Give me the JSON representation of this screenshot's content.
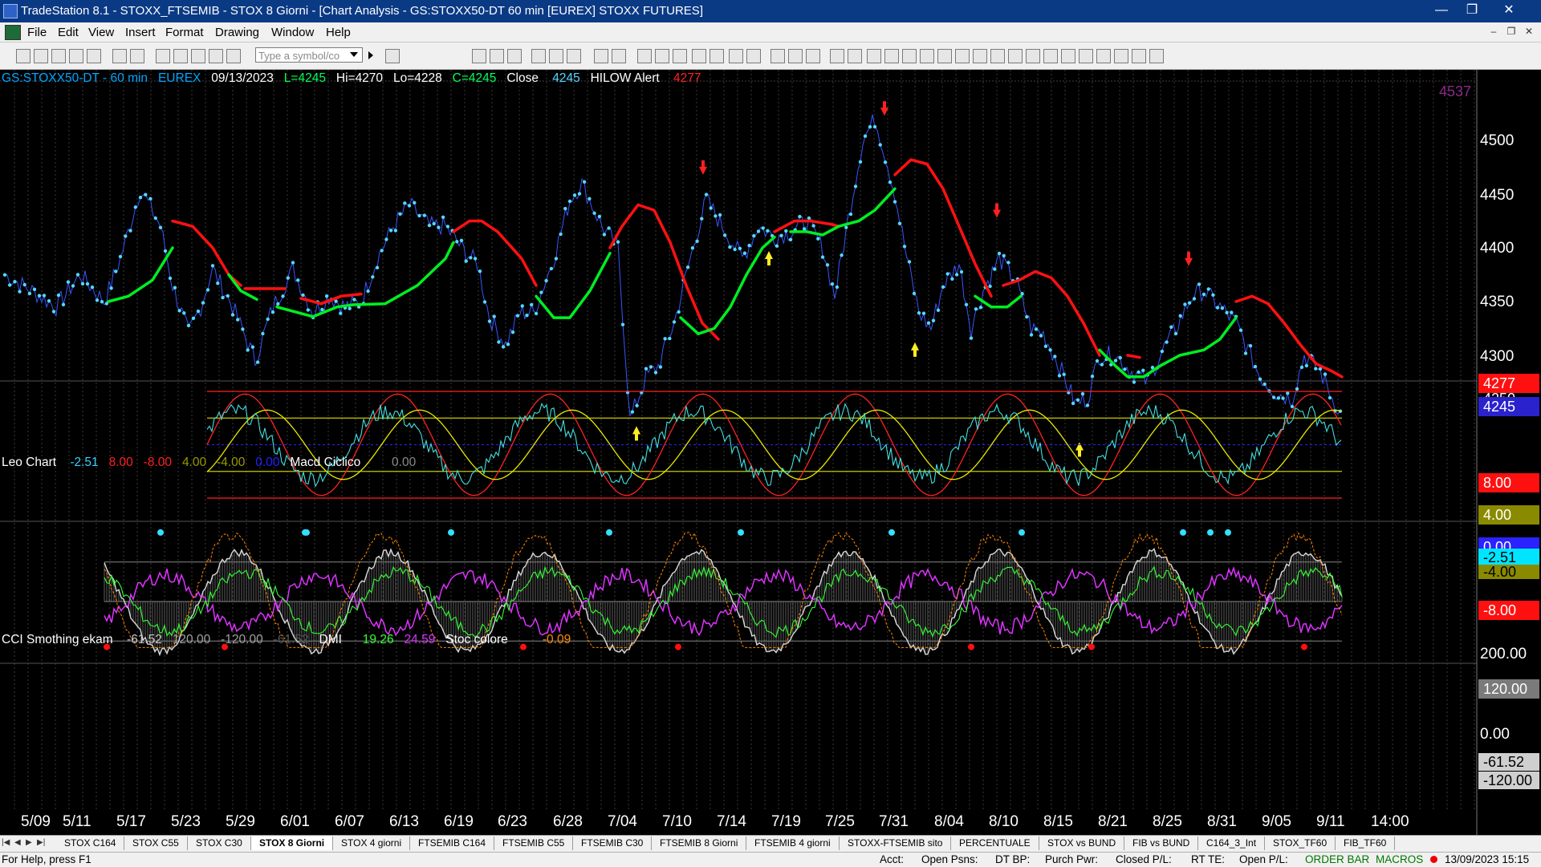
{
  "window": {
    "title": "TradeStation 8.1 - STOXX_FTSEMIB - STOX  8 Giorni - [Chart Analysis - GS:STOXX50-DT  60 min  [EUREX] STOXX FUTURES]",
    "controls": [
      "minimize-icon",
      "restore-icon",
      "close-icon"
    ]
  },
  "menu": {
    "items": [
      "File",
      "Edit",
      "View",
      "Insert",
      "Format",
      "Drawing",
      "Window",
      "Help"
    ]
  },
  "toolbar": {
    "symbol_placeholder": "Type a symbol/co"
  },
  "price_panel": {
    "symbol": "GS:STOXX50-DT - 60 min",
    "exchange": "EUREX",
    "date": "09/13/2023",
    "last": "L=4245",
    "high": "Hi=4270",
    "low": "Lo=4228",
    "close_val": "C=4245",
    "close_label": "Close",
    "close_num": "4245",
    "hilow_label": "HILOW Alert",
    "hilow_num": "4277",
    "top_value": "4537",
    "axis": [
      "4500",
      "4450",
      "4400",
      "4350",
      "4300"
    ],
    "axis_values": [
      4500,
      4450,
      4400,
      4350,
      4300
    ],
    "red_tag": "4277",
    "blue_tag": "4245",
    "hidden_tag": "4250"
  },
  "osc_panel": {
    "name": "Leo Chart",
    "v1": "-2.51",
    "v2": "8.00",
    "v3": "-8.00",
    "v4": "4.00",
    "v5": "-4.00",
    "v6": "0.00",
    "macd_name": "Macd Ciclico",
    "macd_val": "0.00",
    "tags": [
      "8.00",
      "4.00",
      "0.00",
      "-2.51",
      "-4.00",
      "-8.00"
    ]
  },
  "cci_panel": {
    "name": "CCI Smothing ekam",
    "v1": "-61.52",
    "v2": "120.00",
    "v3": "-120.00",
    "v4": "-61.52",
    "dmi_name": "DMI",
    "dmi_v1": "19.26",
    "dmi_v2": "24.59",
    "stoc_name": "Stoc colore",
    "stoc_val": "-0.09",
    "axis": [
      "200.00",
      "120.00",
      "0.00",
      "-61.52",
      "-120.00"
    ]
  },
  "x_axis": [
    "5/09",
    "5/11",
    "5/17",
    "5/23",
    "5/29",
    "6/01",
    "6/07",
    "6/13",
    "6/19",
    "6/23",
    "6/28",
    "7/04",
    "7/10",
    "7/14",
    "7/19",
    "7/25",
    "7/31",
    "8/04",
    "8/10",
    "8/15",
    "8/21",
    "8/25",
    "8/31",
    "9/05",
    "9/11",
    "14:00"
  ],
  "tabs": [
    "STOX C164",
    "STOX C55",
    "STOX  C30",
    "STOX  8 Giorni",
    "STOX 4 giorni",
    "FTSEMIB C164",
    "FTSEMIB C55",
    "FTSEMIB C30",
    "FTSEMIB  8 Giorni",
    "FTSEMIB  4 giorni",
    "STOXX-FTSEMIB sito",
    "PERCENTUALE",
    "STOX vs BUND",
    "FIB vs BUND",
    "C164_3_Int",
    "STOX_TF60",
    "FIB_TF60"
  ],
  "active_tab": "STOX  8 Giorni",
  "status": {
    "help": "For Help, press F1",
    "acct": "Acct:",
    "open_psns": "Open Psns:",
    "dt_bp": "DT BP:",
    "purch_pwr": "Purch Pwr:",
    "closed_pl": "Closed P/L:",
    "rt_te": "RT TE:",
    "open_pl": "Open P/L:",
    "order_bar": "ORDER BAR",
    "macros": "MACROS",
    "datetime": "13/09/2023 15:15"
  },
  "colors": {
    "title_bg": "#0b3a85",
    "price_line": "#55d7ff",
    "ma_up": "#00ee22",
    "ma_down": "#ff1111",
    "purple": "#dd33ff",
    "yellow": "#c8c800",
    "red_level": "#ff2020"
  }
}
